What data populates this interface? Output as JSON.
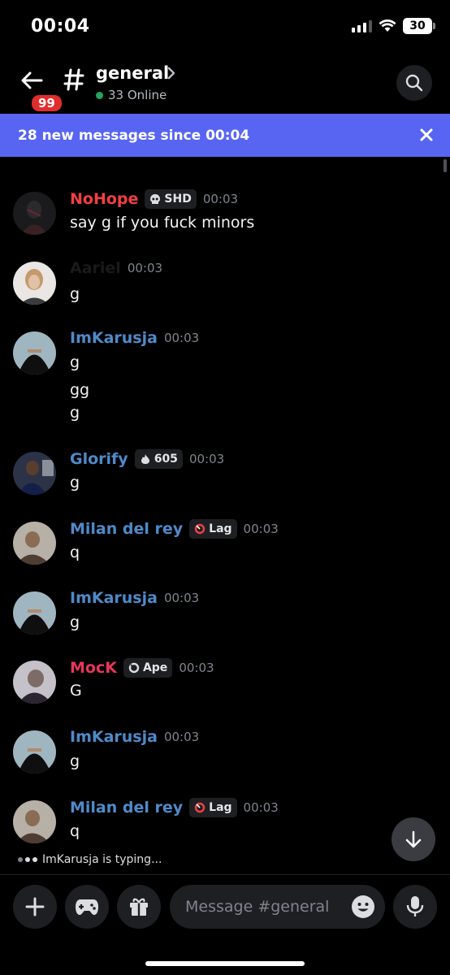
{
  "status_bar": {
    "time": "00:04",
    "battery": "30"
  },
  "header": {
    "unread_badge": "99",
    "channel_name": "general",
    "online_count": "33 Online"
  },
  "banner": {
    "text": "28 new messages since 00:04"
  },
  "messages": [
    {
      "author": "NoHope",
      "author_color": "#f23f43",
      "tag": "SHD",
      "tag_icon": "skull-icon",
      "time": "00:03",
      "lines": [
        "say g if you fuck minors"
      ]
    },
    {
      "author": "Aariel",
      "author_color": "#1a1a1a",
      "tag": "",
      "time": "00:03",
      "lines": [
        "g"
      ]
    },
    {
      "author": "ImKarusja",
      "author_color": "#4f8ac9",
      "tag": "",
      "time": "00:03",
      "lines": [
        "g",
        "gg",
        "g"
      ]
    },
    {
      "author": "Glorify",
      "author_color": "#4f8ac9",
      "tag": "605",
      "tag_icon": "flame-icon",
      "time": "00:03",
      "lines": [
        "g"
      ]
    },
    {
      "author": "Milan del rey",
      "author_color": "#4f8ac9",
      "tag": "Lag",
      "tag_icon": "ring-icon",
      "time": "00:03",
      "lines": [
        "q"
      ]
    },
    {
      "author": "ImKarusja",
      "author_color": "#4f8ac9",
      "tag": "",
      "time": "00:03",
      "lines": [
        "g"
      ]
    },
    {
      "author": "MocK",
      "author_color": "#e8365a",
      "tag": "Ape",
      "tag_icon": "ring-icon",
      "time": "00:03",
      "lines": [
        "G"
      ]
    },
    {
      "author": "ImKarusja",
      "author_color": "#4f8ac9",
      "tag": "",
      "time": "00:03",
      "lines": [
        "g"
      ]
    },
    {
      "author": "Milan del rey",
      "author_color": "#4f8ac9",
      "tag": "Lag",
      "tag_icon": "ring-icon",
      "time": "00:03",
      "lines": [
        "q"
      ]
    }
  ],
  "typing": {
    "text": "ImKarusja is typing..."
  },
  "composer": {
    "placeholder": "Message #general"
  },
  "colors": {
    "accent": "#5865f2",
    "online": "#23a55a",
    "badge": "#e02d2d"
  }
}
